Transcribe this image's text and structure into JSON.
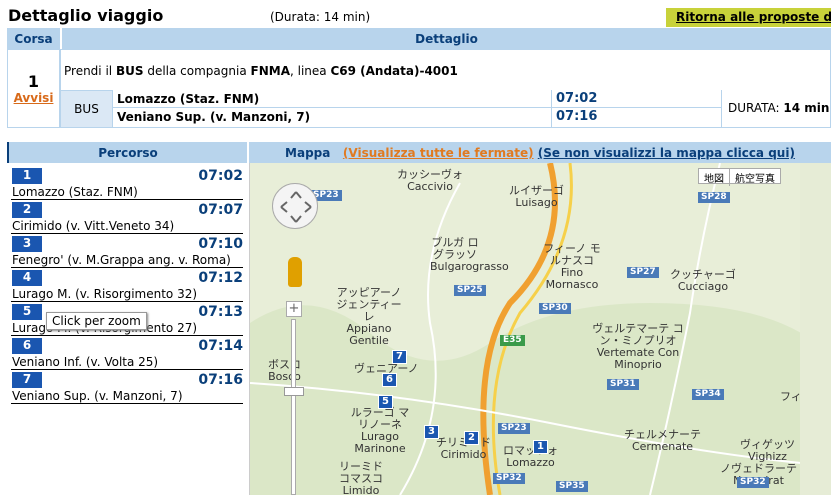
{
  "header": {
    "title": "Dettaglio viaggio",
    "duration": "(Durata: 14 min)",
    "back_label": "Ritorna alle proposte di vi"
  },
  "table": {
    "col_corsa": "Corsa",
    "col_dettaglio": "Dettaglio",
    "corsa_number": "1",
    "avvisi": "Avvisi",
    "line_prefix": "Prendi il",
    "mode_bold": "BUS",
    "line_mid": "della compagnia",
    "company": "FNMA",
    "line_word": ", linea",
    "line_name": "C69 (Andata)-4001",
    "mode": "BUS",
    "from_stop": "Lomazzo (Staz. FNM)",
    "from_time": "07:02",
    "to_stop": "Veniano Sup. (v. Manzoni, 7)",
    "to_time": "07:16",
    "duration_label": "DURATA:",
    "duration_value": "14 min"
  },
  "percorso": {
    "header": "Percorso",
    "stops": [
      {
        "num": "1",
        "time": "07:02",
        "name": "Lomazzo (Staz. FNM)"
      },
      {
        "num": "2",
        "time": "07:07",
        "name": "Cirimido (v. Vitt.Veneto 34)"
      },
      {
        "num": "3",
        "time": "07:10",
        "name": "Fenegro' (v. M.Grappa ang. v. Roma)"
      },
      {
        "num": "4",
        "time": "07:12",
        "name": "Lurago M. (v. Risorgimento 32)"
      },
      {
        "num": "5",
        "time": "07:13",
        "name": "Lurago M. (v. Risorgimento 27)"
      },
      {
        "num": "6",
        "time": "07:14",
        "name": "Veniano Inf. (v. Volta 25)"
      },
      {
        "num": "7",
        "time": "07:16",
        "name": "Veniano Sup. (v. Manzoni, 7)"
      }
    ],
    "tooltip": "Click per zoom"
  },
  "mappa": {
    "header": "Mappa",
    "link_all": "(Visualizza tutte le fermate)",
    "link_alt": "(Se non visualizzi la mappa clicca qui)",
    "map_type_map": "地図",
    "map_type_sat": "航空写真",
    "places": [
      {
        "jp": "カッシーヴォ",
        "it": "Caccivio"
      },
      {
        "jp": "ルイザーゴ",
        "it": "Luisago"
      },
      {
        "jp": "ブルガ ログラッソ",
        "it": "Bulgarograsso"
      },
      {
        "jp": "フィーノ モルナスコ",
        "it": "Fino Mornasco"
      },
      {
        "jp": "クッチャーゴ",
        "it": "Cucciago"
      },
      {
        "jp": "アッピアーノ ジェンティーレ",
        "it": "Appiano Gentile"
      },
      {
        "jp": "ヴェルテマーテ コン・ミノプリオ",
        "it": "Vertemate Con Minoprio"
      },
      {
        "jp": "ボスコ",
        "it": "Bosco"
      },
      {
        "jp": "ヴェニアーノ",
        "it": ""
      },
      {
        "jp": "ルラーゴ マリノーネ",
        "it": "Lurago Marinone"
      },
      {
        "jp": "チリミード",
        "it": "Cirimido"
      },
      {
        "jp": "ロマッツォ",
        "it": "Lomazzo"
      },
      {
        "jp": "チェルメナーテ",
        "it": "Cermenate"
      },
      {
        "jp": "リーミド コマスコ",
        "it": "Limido"
      },
      {
        "jp": "フィ",
        "it": ""
      },
      {
        "jp": "ヴィゲッツ",
        "it": "Vighizz"
      },
      {
        "jp": "ノヴェドラーテ",
        "it": "Novedrat"
      }
    ],
    "roads": [
      "SP23",
      "SP28",
      "SP25",
      "SP27",
      "SP30",
      "E35",
      "SP31",
      "SP34",
      "SP23",
      "SP32",
      "SP32",
      "SP35"
    ]
  },
  "colors": {
    "header_bg": "#b8d4ec",
    "header_text": "#0a3f7a",
    "accent_orange": "#e07a20",
    "back_button_bg": "#c8d23a",
    "marker_blue": "#1a56b0",
    "highway": "#f0a030"
  }
}
